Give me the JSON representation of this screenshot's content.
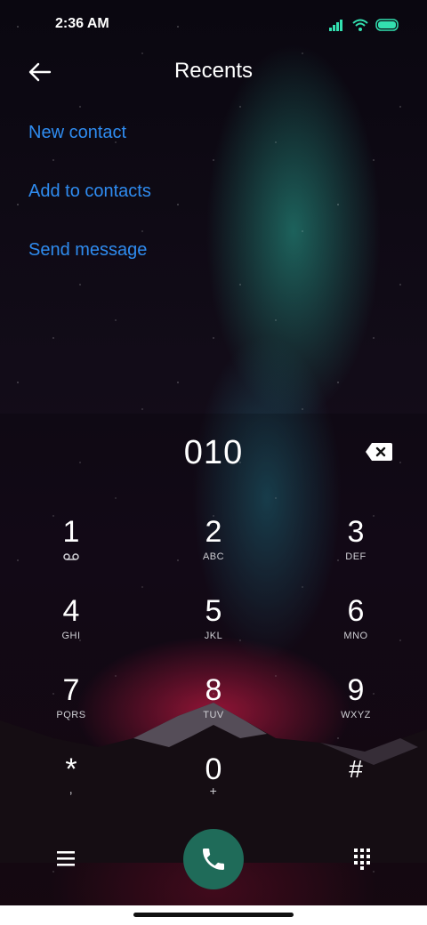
{
  "status_bar": {
    "time": "2:36 AM"
  },
  "header": {
    "title": "Recents"
  },
  "menu": [
    {
      "label": "New contact"
    },
    {
      "label": "Add to contacts"
    },
    {
      "label": "Send message"
    }
  ],
  "dialer": {
    "number": "010",
    "keys": [
      {
        "digit": "1",
        "letters": ""
      },
      {
        "digit": "2",
        "letters": "ABC"
      },
      {
        "digit": "3",
        "letters": "DEF"
      },
      {
        "digit": "4",
        "letters": "GHI"
      },
      {
        "digit": "5",
        "letters": "JKL"
      },
      {
        "digit": "6",
        "letters": "MNO"
      },
      {
        "digit": "7",
        "letters": "PQRS"
      },
      {
        "digit": "8",
        "letters": "TUV"
      },
      {
        "digit": "9",
        "letters": "WXYZ"
      },
      {
        "digit": "*",
        "letters": ","
      },
      {
        "digit": "0",
        "letters": "+"
      },
      {
        "digit": "#",
        "letters": ""
      }
    ]
  },
  "colors": {
    "link": "#2f8cf0",
    "call_button": "#1f6b59",
    "battery": "#33e0b0"
  }
}
